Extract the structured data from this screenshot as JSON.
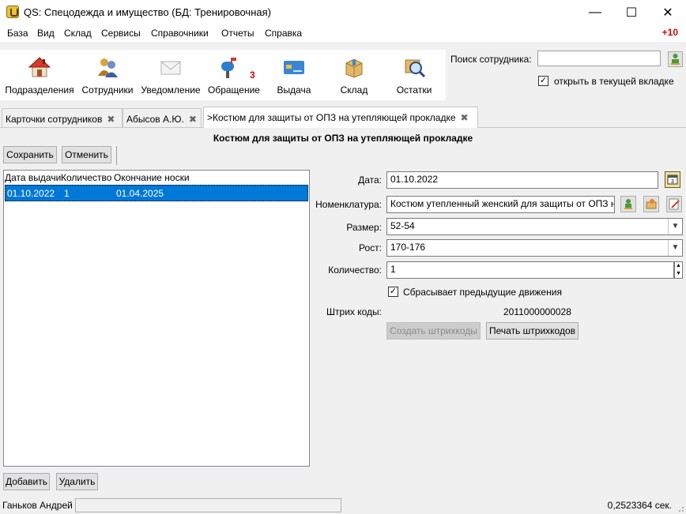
{
  "app": {
    "title": "QS: Спецодежда и имущество (БД: Тренировочная)"
  },
  "window_controls": {
    "minimize": "—",
    "maximize": "☐",
    "close": "✕"
  },
  "menu": {
    "items": [
      "База",
      "Вид",
      "Склад",
      "Сервисы",
      "Справочники",
      "Отчеты",
      "Справка"
    ],
    "notification": "+10"
  },
  "toolbar": {
    "buttons": [
      {
        "label": "Подразделения",
        "icon": "house-icon"
      },
      {
        "label": "Сотрудники",
        "icon": "people-icon"
      },
      {
        "label": "Уведомление",
        "icon": "envelope-icon"
      },
      {
        "label": "Обращение",
        "icon": "mailbox-icon",
        "badge": "3"
      },
      {
        "label": "Выдача",
        "icon": "card-icon"
      },
      {
        "label": "Склад",
        "icon": "box-icon"
      },
      {
        "label": "Остатки",
        "icon": "magnifier-icon"
      }
    ]
  },
  "search": {
    "label": "Поиск сотрудника:",
    "value": "",
    "open_in_current_tab_label": "открыть в текущей вкладке",
    "open_in_current_tab_checked": true
  },
  "tabs": [
    {
      "label": "Карточки сотрудников",
      "active": false
    },
    {
      "label": "Абысов А.Ю.",
      "active": false
    },
    {
      "label": ">Костюм для защиты от ОПЗ  на утепляющей прокладке",
      "active": true
    }
  ],
  "document": {
    "heading": "Костюм для защиты от ОПЗ  на утепляющей прокладке",
    "save_label": "Сохранить",
    "cancel_label": "Отменить"
  },
  "issues_table": {
    "columns": [
      "Дата выдачи",
      "Количество",
      "Окончание носки"
    ],
    "rows": [
      {
        "date": "01.10.2022",
        "quantity": "1",
        "end_date": "01.04.2025",
        "selected": true
      }
    ],
    "add_label": "Добавить",
    "delete_label": "Удалить"
  },
  "form": {
    "date_label": "Дата:",
    "date_value": "01.10.2022",
    "nomenclature_label": "Номенклатура:",
    "nomenclature_value": "Костюм утепленный женский для защиты от ОПЗ на утепляющей прокладке",
    "size_label": "Размер:",
    "size_value": "52-54",
    "height_label": "Рост:",
    "height_value": "170-176",
    "quantity_label": "Количество:",
    "quantity_value": "1",
    "reset_label": "Сбрасывает предыдущие движения",
    "reset_checked": true,
    "barcodes_label": "Штрих коды:",
    "barcode_value": "2011000000028",
    "create_barcodes_label": "Создать штрихкоды",
    "print_barcodes_label": "Печать штрихкодов"
  },
  "statusbar": {
    "user": "Ганьков Андрей",
    "time": "0,2523364 сек."
  }
}
